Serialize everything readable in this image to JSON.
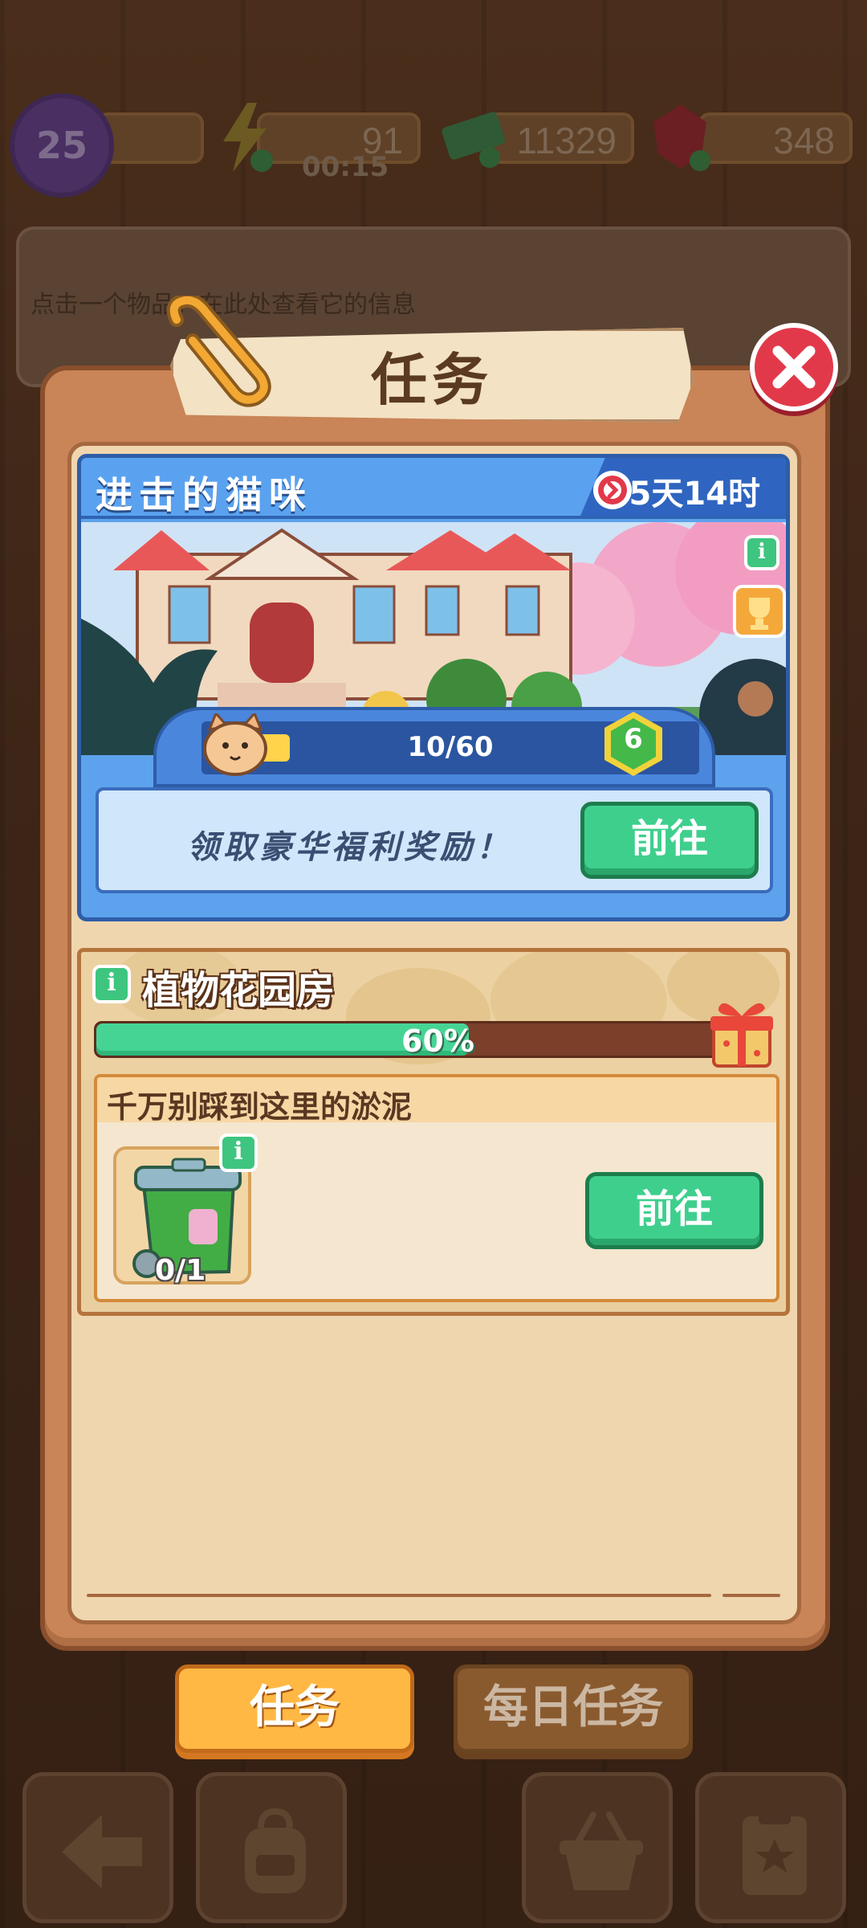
{
  "hud": {
    "level": "25",
    "energy": "91",
    "energy_timer": "00:15",
    "cash": "11329",
    "gems": "348"
  },
  "info_panel": {
    "hint": "点击一个物品，在此处查看它的信息"
  },
  "dialog": {
    "title": "任务"
  },
  "event": {
    "title": "进击的猫咪",
    "timer": "5天14时",
    "progress_text": "10/60",
    "progress_fraction": 0.1667,
    "level": "6",
    "reward_text": "领取豪华福利奖励！",
    "go_label": "前往"
  },
  "task": {
    "title": "植物花园房",
    "progress_text": "60%",
    "progress_fraction": 0.6,
    "subtask": {
      "title": "千万别踩到这里的淤泥",
      "item_icon": "green-trash-bin",
      "item_count": "0/1",
      "go_label": "前往"
    }
  },
  "tabs": {
    "active": "任务",
    "daily": "每日任务"
  },
  "nav": {
    "items": [
      "back-arrow-icon",
      "backpack-icon",
      "shop-basket-icon",
      "clipboard-star-icon"
    ]
  },
  "colors": {
    "accent_orange": "#ffb844",
    "go_green": "#3fcf8d",
    "event_blue": "#5da2ec",
    "close_red": "#e2394a"
  }
}
